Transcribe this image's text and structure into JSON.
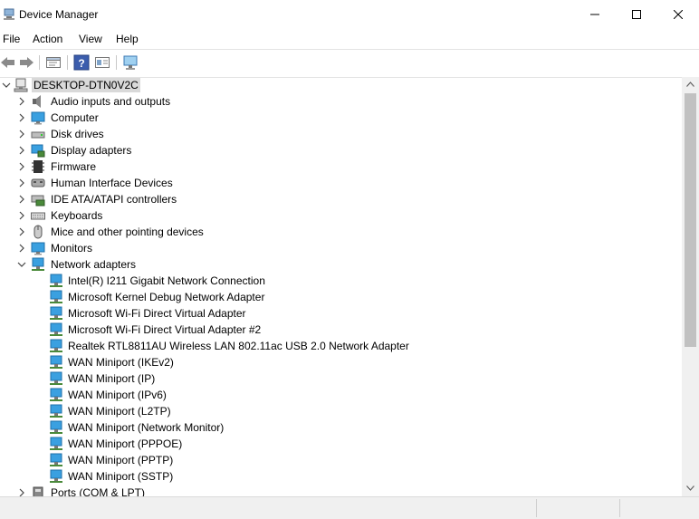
{
  "window": {
    "title": "Device Manager"
  },
  "menu": {
    "items": [
      "File",
      "Action",
      "View",
      "Help"
    ]
  },
  "toolbar": {
    "icons": [
      "back-arrow-icon",
      "forward-arrow-icon",
      "properties-icon",
      "help-icon",
      "update-driver-icon",
      "monitor-scan-icon"
    ]
  },
  "tree": {
    "root": "DESKTOP-DTN0V2C",
    "categories": [
      "Audio inputs and outputs",
      "Computer",
      "Disk drives",
      "Display adapters",
      "Firmware",
      "Human Interface Devices",
      "IDE ATA/ATAPI controllers",
      "Keyboards",
      "Mice and other pointing devices",
      "Monitors",
      "Network adapters",
      "Ports (COM & LPT)"
    ],
    "expanded": "Network adapters",
    "network_adapters": [
      "Intel(R) I211 Gigabit Network Connection",
      "Microsoft Kernel Debug Network Adapter",
      "Microsoft Wi-Fi Direct Virtual Adapter",
      "Microsoft Wi-Fi Direct Virtual Adapter #2",
      "Realtek RTL8811AU Wireless LAN 802.11ac USB 2.0 Network Adapter",
      "WAN Miniport (IKEv2)",
      "WAN Miniport (IP)",
      "WAN Miniport (IPv6)",
      "WAN Miniport (L2TP)",
      "WAN Miniport (Network Monitor)",
      "WAN Miniport (PPPOE)",
      "WAN Miniport (PPTP)",
      "WAN Miniport (SSTP)"
    ]
  }
}
